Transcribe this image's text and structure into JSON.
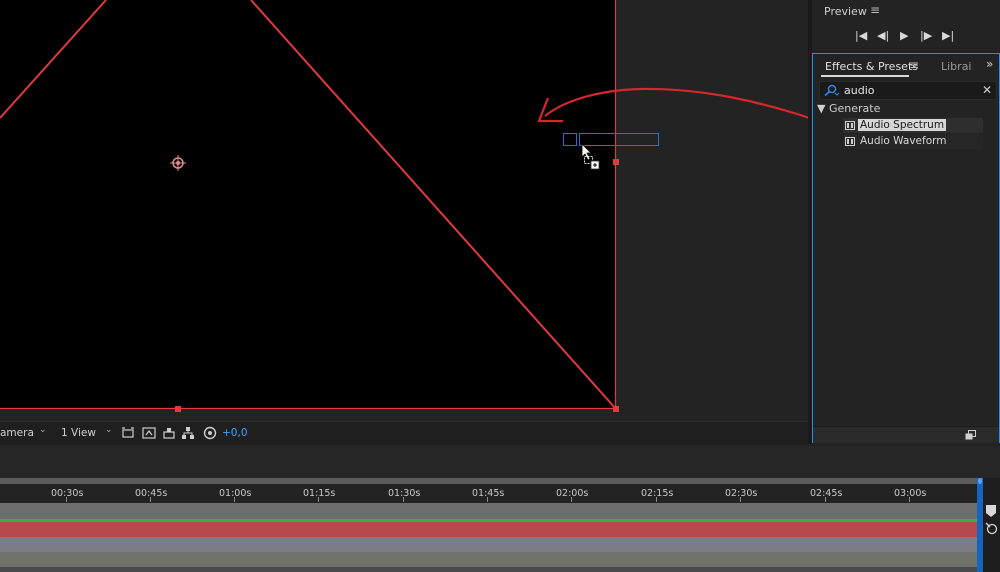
{
  "viewer": {
    "camera_label": "amera",
    "view_label": "1 View",
    "exposure_value": "+0,0",
    "colors": {
      "mask": "#e0393e",
      "selection_box": "#2a6fc9",
      "canvas": "#000000"
    }
  },
  "preview": {
    "title": "Preview",
    "menu_icon": "hamburger-icon",
    "controls": [
      "skip-to-start-icon",
      "step-back-icon",
      "play-icon",
      "step-forward-icon",
      "skip-to-end-icon"
    ]
  },
  "effects_panel": {
    "tab_label": "Effects & Presets",
    "other_tab_label": "Librai",
    "search": {
      "value": "audio",
      "placeholder": ""
    },
    "group": {
      "label": "Generate",
      "expanded": true
    },
    "items": [
      {
        "label": "Audio Spectrum",
        "selected": true
      },
      {
        "label": "Audio Waveform",
        "selected": false
      }
    ],
    "accent_color": "#2d8ceb"
  },
  "timeline": {
    "ticks": [
      "00:30s",
      "00:45s",
      "01:00s",
      "01:15s",
      "01:30s",
      "01:45s",
      "02:00s",
      "02:15s",
      "02:30s",
      "02:45s",
      "03:00s"
    ],
    "layer_colors": [
      "#6e6e6e",
      "#36b24a",
      "#b5494d",
      "#7c7c86",
      "#6e746c"
    ]
  }
}
